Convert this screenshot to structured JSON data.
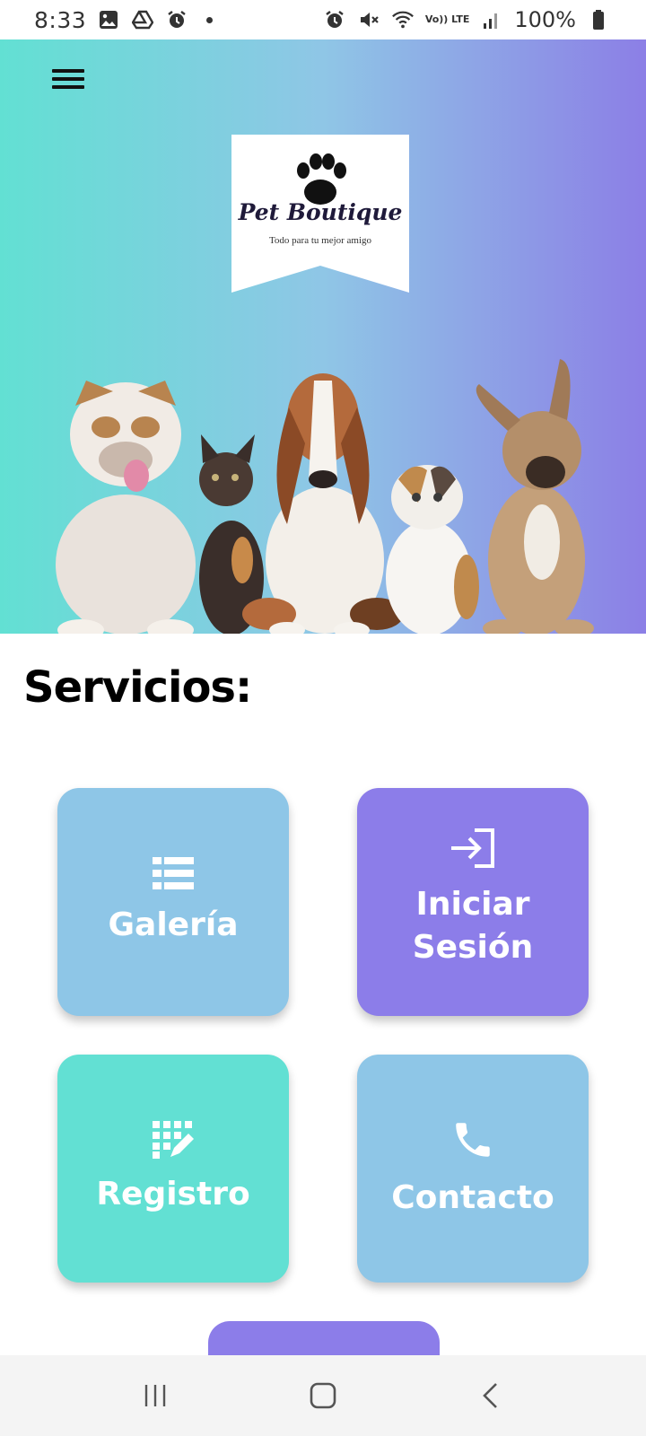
{
  "status_bar": {
    "time": "8:33",
    "left_icons": [
      "image-icon",
      "drive-icon",
      "alarm-icon",
      "dot-icon"
    ],
    "right_icons": [
      "alarm-icon",
      "mute-icon",
      "wifi-icon",
      "volte-icon",
      "signal-icon",
      "battery-icon"
    ],
    "volte_label": "Vo)) LTE",
    "battery_percent": "100%"
  },
  "header": {
    "menu_icon": "hamburger-menu-icon",
    "logo": {
      "brand": "Pet Boutique",
      "tagline": "Todo para tu mejor amigo",
      "icon": "paw-print-icon"
    },
    "hero_image": "pets-banner"
  },
  "services": {
    "title": "Servicios:",
    "cards": [
      {
        "label": "Galería",
        "icon": "list-icon",
        "color": "#8ec6e7"
      },
      {
        "label": "Iniciar Sesión",
        "icon": "login-icon",
        "color": "#8c7de9"
      },
      {
        "label": "Registro",
        "icon": "register-icon",
        "color": "#62e0d3"
      },
      {
        "label": "Contacto",
        "icon": "phone-icon",
        "color": "#8ec6e7"
      }
    ]
  },
  "nav_bar": {
    "items": [
      "recent-apps-icon",
      "home-icon",
      "back-icon"
    ]
  },
  "colors": {
    "teal": "#62e0d3",
    "sky": "#8ec6e7",
    "purple": "#8c7de9"
  }
}
